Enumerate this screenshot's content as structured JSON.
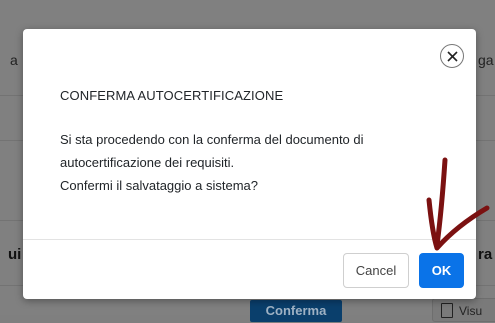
{
  "background": {
    "left_fragment_top": "a",
    "right_fragment_top": "ga",
    "left_fragment_bold": "ui",
    "right_fragment_bold": "ra",
    "confirm_button": "Conferma",
    "view_button": "Visu"
  },
  "modal": {
    "title": "CONFERMA AUTOCERTIFICAZIONE",
    "body_lines": [
      "Si sta procedendo con la conferma del documento di",
      "autocertificazione dei requisiti.",
      "Confermi il salvataggio a sistema?"
    ],
    "cancel_label": "Cancel",
    "ok_label": "OK",
    "close_icon": "close-icon"
  },
  "annotation": {
    "arrow_color": "#7b1111"
  }
}
